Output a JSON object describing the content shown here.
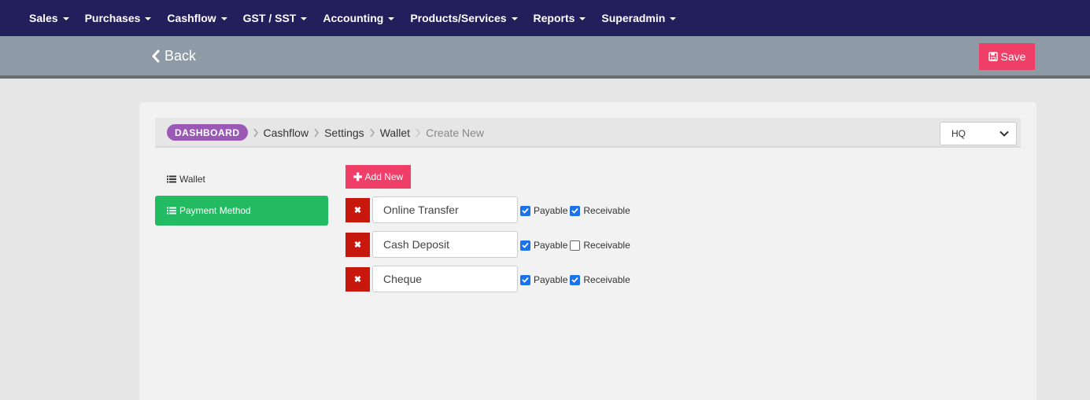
{
  "nav": {
    "items": [
      "Sales",
      "Purchases",
      "Cashflow",
      "GST / SST",
      "Accounting",
      "Products/Services",
      "Reports",
      "Superadmin"
    ]
  },
  "toolbar": {
    "back_label": "Back",
    "save_label": "Save"
  },
  "breadcrumb": {
    "dashboard": "DASHBOARD",
    "items": [
      "Cashflow",
      "Settings",
      "Wallet"
    ],
    "current": "Create New"
  },
  "branch_select": {
    "value": "HQ"
  },
  "sidebar": {
    "wallet": "Wallet",
    "payment_method": "Payment Method"
  },
  "add_new_label": "Add New",
  "payment_methods": [
    {
      "name": "Online Transfer",
      "payable": true,
      "receivable": true
    },
    {
      "name": "Cash Deposit",
      "payable": true,
      "receivable": false
    },
    {
      "name": "Cheque",
      "payable": true,
      "receivable": true
    }
  ],
  "labels": {
    "payable": "Payable",
    "receivable": "Receivable"
  },
  "colors": {
    "navbar": "#221f5c",
    "subbar": "#8e9aa5",
    "accent_pink": "#ef3f69",
    "active_green": "#22bb62",
    "delete_red": "#c8170d",
    "dashboard_badge": "#9b59b6",
    "checkbox_blue": "#1a73e8"
  },
  "icons": {
    "back": "chevron-left-icon",
    "save": "floppy-disk-icon",
    "list": "list-icon",
    "delete": "close-icon",
    "dropdown": "chevron-down-icon"
  }
}
